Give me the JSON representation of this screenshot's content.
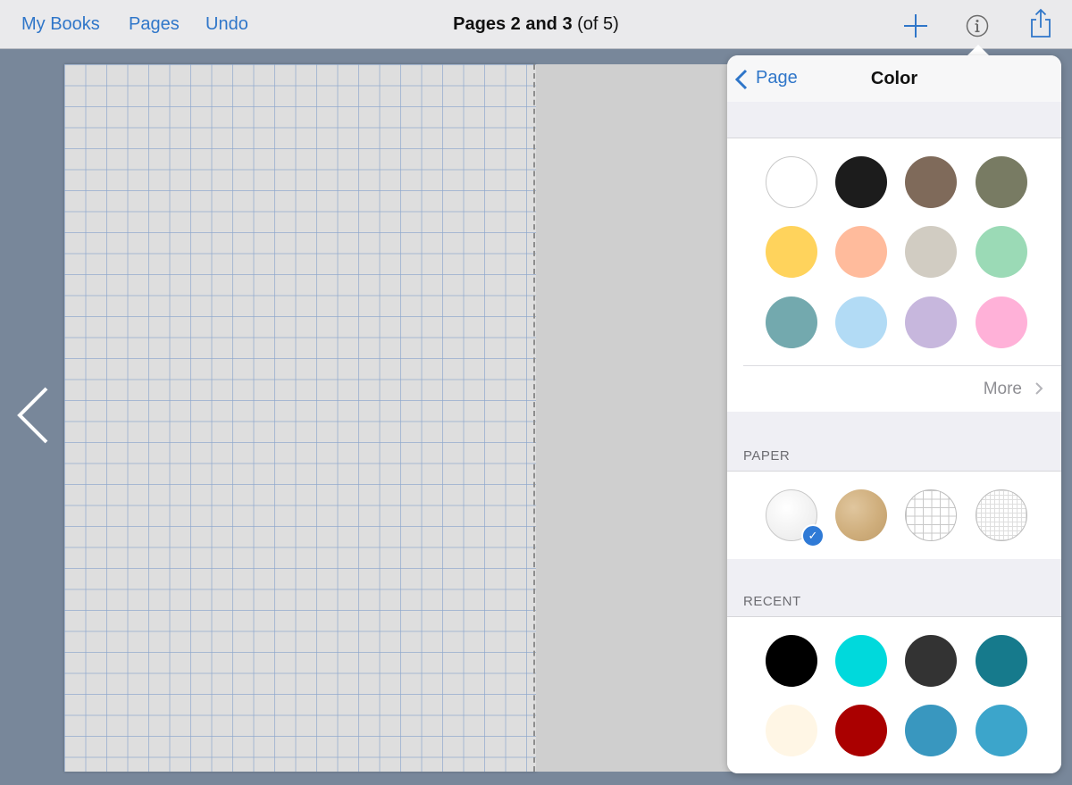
{
  "toolbar": {
    "my_books": "My Books",
    "pages": "Pages",
    "undo": "Undo",
    "title_main": "Pages 2 and 3",
    "title_suffix": "(of 5)",
    "icons": [
      "add-icon",
      "info-icon",
      "share-icon"
    ]
  },
  "popover": {
    "back_label": "Page",
    "title": "Color",
    "colors": [
      "#ffffff",
      "#1c1c1c",
      "#7f6a5a",
      "#787b63",
      "#ffd35c",
      "#ffbb9c",
      "#d1ccc2",
      "#9bdab6",
      "#73a9ae",
      "#b2dbf5",
      "#c7b7dd",
      "#ffb1d8"
    ],
    "more_label": "More",
    "paper_label": "PAPER",
    "paper_options": [
      "white-paper",
      "kraft-paper",
      "grid-paper",
      "fine-grid-paper"
    ],
    "paper_selected": 0,
    "recent_label": "RECENT",
    "recent_colors": [
      "#000000",
      "#00d9dc",
      "#333333",
      "#167a8c",
      "#fff6e5",
      "#aa0000",
      "#3997bf",
      "#3ca5cb"
    ]
  },
  "accent_color": "#2f76c9"
}
